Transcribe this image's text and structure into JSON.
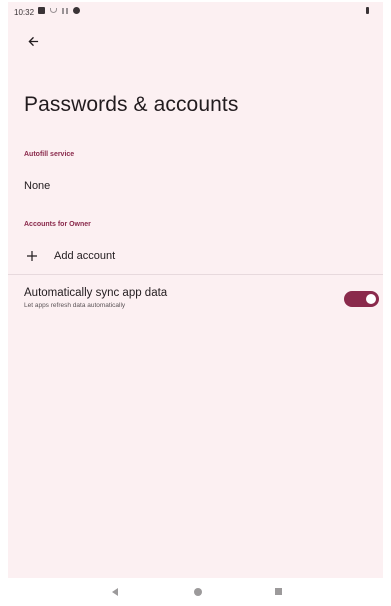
{
  "status_bar": {
    "time": "10:32",
    "icons": [
      "notification-box-icon",
      "wifi-icon",
      "signal-icon",
      "settings-gear-icon",
      "battery-icon"
    ]
  },
  "header": {
    "back_icon": "arrow-back-icon",
    "title": "Passwords & accounts"
  },
  "autofill": {
    "section_label": "Autofill service",
    "value": "None"
  },
  "accounts": {
    "section_label": "Accounts for Owner",
    "add_icon": "plus-icon",
    "add_label": "Add account"
  },
  "sync": {
    "title": "Automatically sync app data",
    "subtitle": "Let apps refresh data automatically",
    "enabled": true
  },
  "colors": {
    "accent": "#8a2a4c",
    "background": "#fcf0f2"
  },
  "nav_bar": {
    "icons": [
      "nav-back-icon",
      "nav-home-icon",
      "nav-recents-icon"
    ]
  }
}
